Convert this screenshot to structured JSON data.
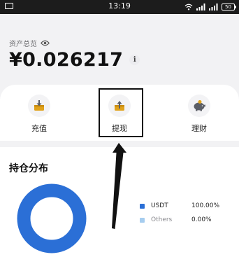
{
  "status_bar": {
    "time": "13:19",
    "battery": "50",
    "icons": [
      "mail-icon",
      "wifi-icon",
      "signal-icon",
      "battery-icon"
    ]
  },
  "asset": {
    "label": "资产总览",
    "value": "¥0.026217",
    "info": "i"
  },
  "actions": [
    {
      "label": "充值",
      "icon": "deposit-icon"
    },
    {
      "label": "提现",
      "icon": "withdraw-icon"
    },
    {
      "label": "理财",
      "icon": "piggy-bank-icon"
    }
  ],
  "holdings": {
    "title": "持仓分布",
    "legend": [
      {
        "name": "USDT",
        "percent": "100.00%",
        "color": "#2b6fd6"
      },
      {
        "name": "Others",
        "percent": "0.00%",
        "color": "#a6cdef"
      }
    ]
  },
  "chart_data": {
    "type": "pie",
    "categories": [
      "USDT",
      "Others"
    ],
    "values": [
      100.0,
      0.0
    ],
    "colors": [
      "#2b6fd6",
      "#a6cdef"
    ],
    "style": "donut"
  },
  "colors": {
    "accent": "#2b6fd6",
    "accent_light": "#a6cdef",
    "icon_gold": "#e0a21a",
    "icon_gray": "#5b5e66"
  }
}
